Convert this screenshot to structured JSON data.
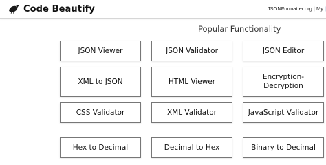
{
  "header": {
    "logo_text": "Code Beautify",
    "logo_icon": "bird-icon",
    "links": {
      "main": "JSONFormatter.org",
      "separator": "|",
      "partial": "My",
      "partial2": "|"
    }
  },
  "section": {
    "title": "Popular Functionality"
  },
  "tools": [
    "JSON Viewer",
    "JSON Validator",
    "JSON Editor",
    "XML to JSON",
    "HTML Viewer",
    "Encryption-Decryption",
    "CSS Validator",
    "XML Validator",
    "JavaScript Validator",
    "Hex to Decimal",
    "Decimal to Hex",
    "Binary to Decimal"
  ]
}
